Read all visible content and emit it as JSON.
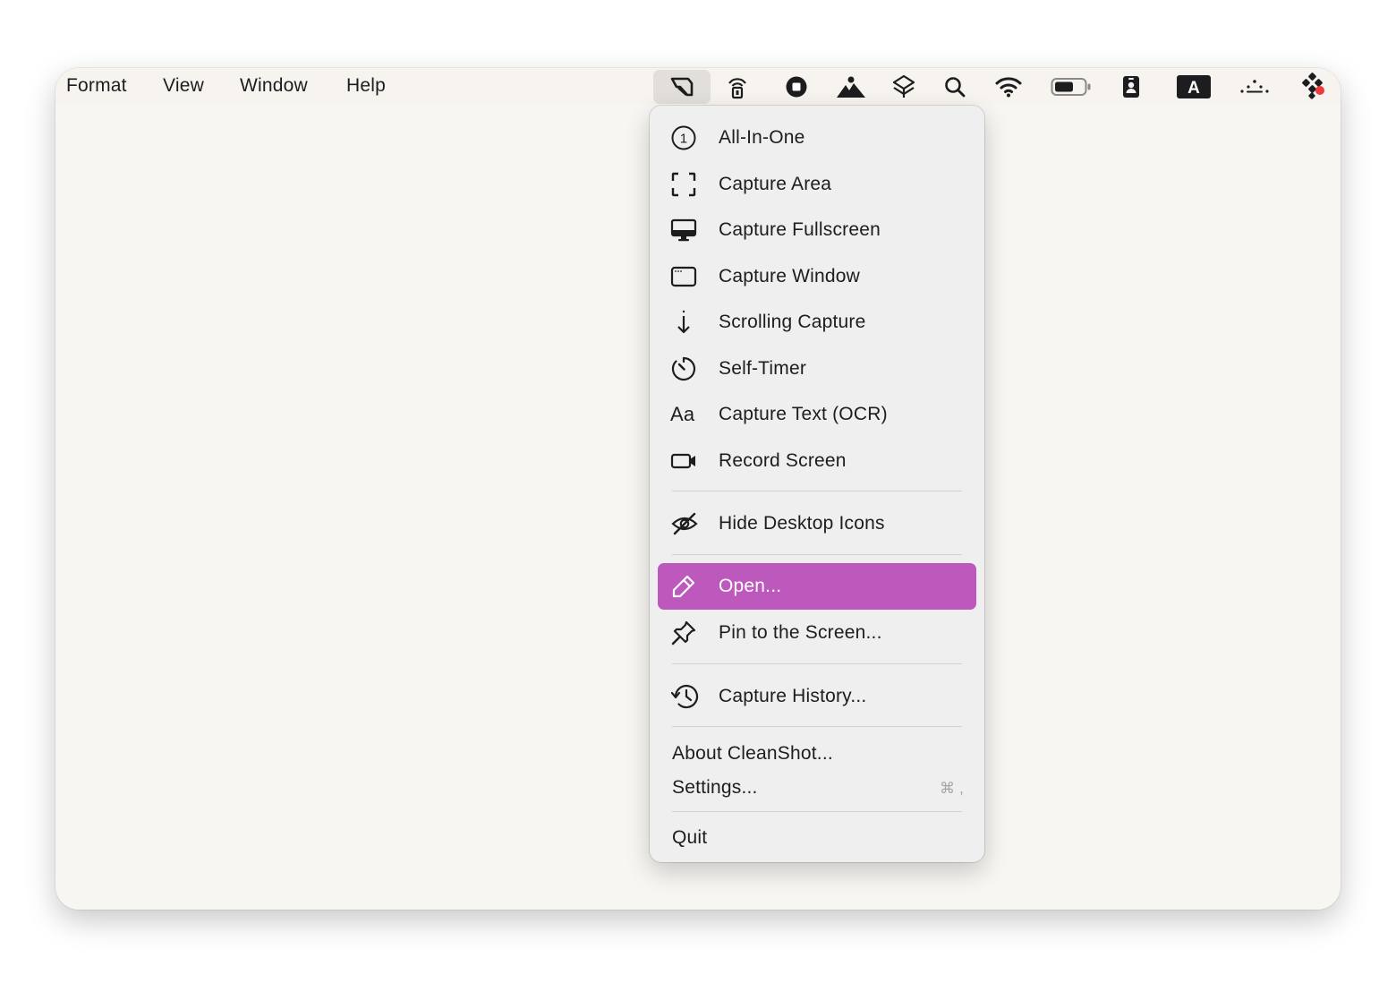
{
  "app_menus": [
    "Format",
    "View",
    "Window",
    "Help"
  ],
  "status_icons": [
    "cleanshot-icon",
    "airdrop-icon",
    "record-stop-icon",
    "mountains-icon",
    "layers-icon",
    "search-icon",
    "wifi-icon",
    "battery-icon",
    "id-badge-icon",
    "keyboard-input-icon",
    "dots-icon",
    "control-center-icon"
  ],
  "menu": {
    "capture_items": [
      {
        "label": "All-In-One",
        "icon": "all-in-one-icon"
      },
      {
        "label": "Capture Area",
        "icon": "capture-area-icon"
      },
      {
        "label": "Capture Fullscreen",
        "icon": "monitor-icon"
      },
      {
        "label": "Capture Window",
        "icon": "window-icon"
      },
      {
        "label": "Scrolling Capture",
        "icon": "arrow-down-icon"
      },
      {
        "label": "Self-Timer",
        "icon": "timer-icon"
      },
      {
        "label": "Capture Text (OCR)",
        "icon": "text-aa-icon"
      },
      {
        "label": "Record Screen",
        "icon": "video-camera-icon"
      }
    ],
    "hide_icons": {
      "label": "Hide Desktop Icons",
      "icon": "eye-slash-icon"
    },
    "open": {
      "label": "Open...",
      "icon": "pencil-icon"
    },
    "pin": {
      "label": "Pin to the Screen...",
      "icon": "pin-icon"
    },
    "history": {
      "label": "Capture History...",
      "icon": "history-icon"
    },
    "about": "About CleanShot...",
    "settings": {
      "label": "Settings...",
      "shortcut": "⌘ ,"
    },
    "quit": "Quit",
    "icon_text": {
      "ocr": "Aa",
      "one": "1",
      "badge": "A"
    }
  },
  "colors": {
    "highlight": "#bd59bd",
    "window_bg": "#f8f6f2",
    "menu_bg": "#efefef",
    "notification_dot": "#ef3b3b"
  }
}
